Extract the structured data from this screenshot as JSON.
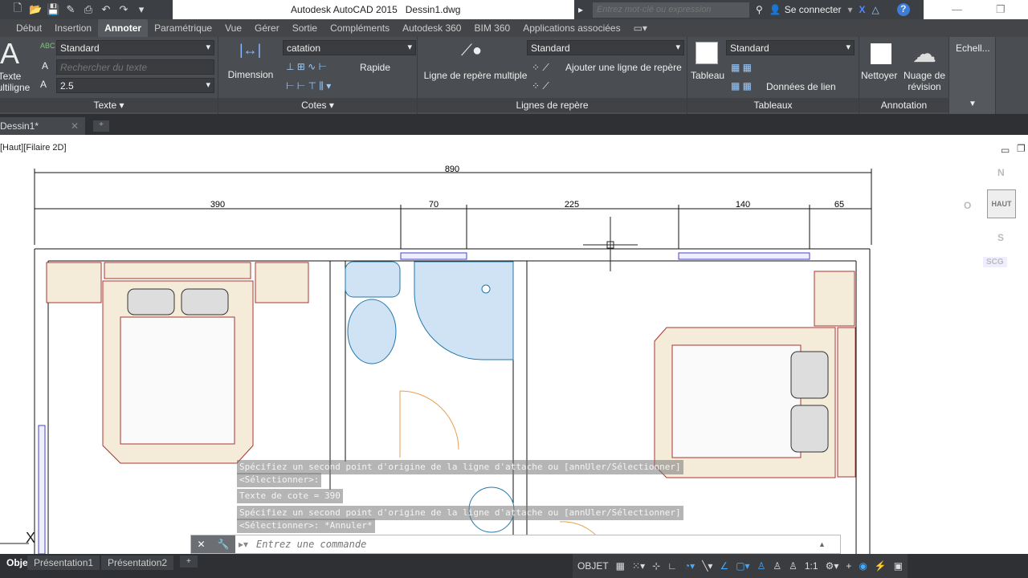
{
  "titlebar": {
    "app": "Autodesk AutoCAD 2015",
    "file": "Dessin1.dwg",
    "search_placeholder": "Entrez mot-clé ou expression",
    "sign_in": "Se connecter"
  },
  "ribbon_tabs": [
    "Début",
    "Insertion",
    "Annoter",
    "Paramétrique",
    "Vue",
    "Gérer",
    "Sortie",
    "Compléments",
    "Autodesk 360",
    "BIM 360",
    "Applications associées"
  ],
  "active_tab": "Annoter",
  "panels": {
    "texte": {
      "title": "Texte",
      "big_button": "Texte multiligne",
      "style": "Standard",
      "search_placeholder": "Rechercher du texte",
      "height": "2.5"
    },
    "cotes": {
      "title": "Cotes",
      "big_button": "Dimension",
      "style": "catation",
      "quick": "Rapide"
    },
    "lignes": {
      "title": "Lignes de repère",
      "big_button": "Ligne de repère multiple",
      "style": "Standard",
      "add": "Ajouter une ligne de repère"
    },
    "tableaux": {
      "title": "Tableaux",
      "big_button": "Tableau",
      "style": "Standard",
      "link": "Données de lien"
    },
    "annotation": {
      "title": "Annotation",
      "clean": "Nettoyer",
      "cloud": "Nuage de révision"
    },
    "echelle": {
      "title": "Echell..."
    }
  },
  "doc_tab": "Dessin1*",
  "viewport_label": "[Haut][Filaire 2D]",
  "viewcube": {
    "north": "N",
    "south": "S",
    "west": "O",
    "face": "HAUT",
    "ucs": "SCG"
  },
  "dimensions": {
    "total": "890",
    "segments": [
      "390",
      "70",
      "225",
      "140",
      "65"
    ]
  },
  "command_history": [
    "Spécifiez un second point d'origine de la ligne d'attache ou [annUler/Sélectionner]",
    "<Sélectionner>:",
    "Texte de cote = 390",
    "Spécifiez un second point d'origine de la ligne d'attache ou [annUler/Sélectionner]",
    "<Sélectionner>: *Annuler*"
  ],
  "command_placeholder": "Entrez une commande",
  "layout_tabs": [
    "Objet",
    "Présentation1",
    "Présentation2"
  ],
  "status": {
    "mode": "OBJET",
    "scale": "1:1"
  }
}
